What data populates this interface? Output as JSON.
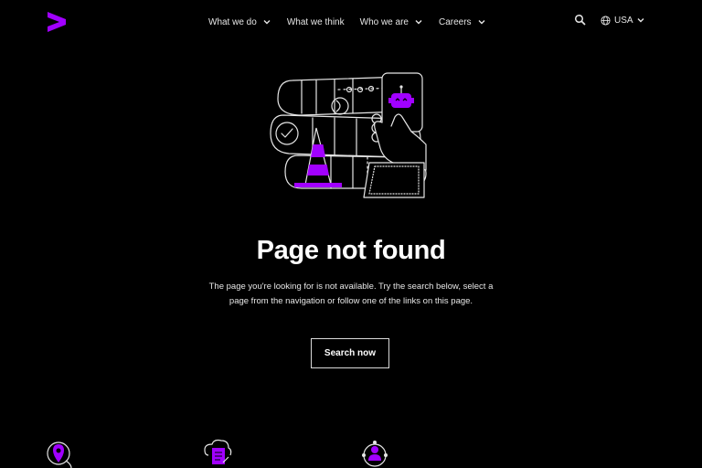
{
  "header": {
    "nav": [
      {
        "label": "What we do",
        "has_dropdown": true
      },
      {
        "label": "What we think",
        "has_dropdown": false
      },
      {
        "label": "Who we are",
        "has_dropdown": true
      },
      {
        "label": "Careers",
        "has_dropdown": true
      }
    ],
    "locale": "USA",
    "icons": {
      "logo": "accenture-greater-than-logo-icon",
      "search": "search-icon",
      "globe": "globe-icon",
      "chevron": "chevron-down-icon"
    }
  },
  "main": {
    "title": "Page not found",
    "message": "The page you're looking for is not available. Try the search below, select a page from the navigation or follow one of the links on this page.",
    "cta_label": "Search now"
  },
  "colors": {
    "background": "#000000",
    "text": "#ffffff",
    "accent": "#a100ff"
  },
  "bottom_icons": [
    "location-pin-icon",
    "document-cloud-icon",
    "person-network-icon"
  ]
}
